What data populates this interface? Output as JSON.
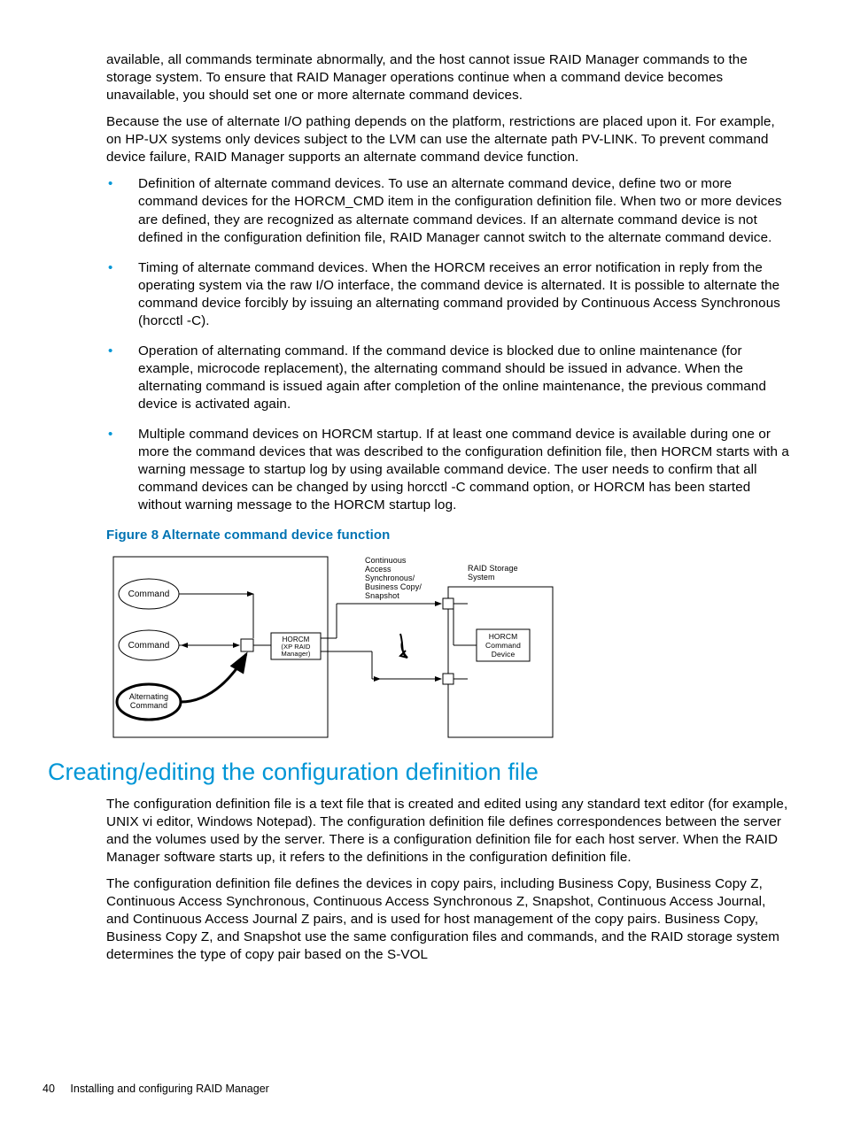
{
  "paragraphs": {
    "p1": "available, all commands terminate abnormally, and the host cannot issue RAID Manager commands to the storage system. To ensure that RAID Manager operations continue when a command device becomes unavailable, you should set one or more alternate command devices.",
    "p2": "Because the use of alternate I/O pathing depends on the platform, restrictions are placed upon it. For example, on HP-UX systems only devices subject to the LVM can use the alternate path PV-LINK. To prevent command device failure, RAID Manager supports an alternate command device function."
  },
  "bullets": [
    "Definition of alternate command devices. To use an alternate command device, define two or more command devices for the HORCM_CMD item in the configuration definition file. When two or more devices are defined, they are recognized as alternate command devices. If an alternate command device is not defined in the configuration definition file, RAID Manager cannot switch to the alternate command device.",
    "Timing of alternate command devices. When the HORCM receives an error notification in reply from the operating system via the raw I/O interface, the command device is alternated. It is possible to alternate the command device forcibly by issuing an alternating command provided by Continuous Access Synchronous (horcctl -C).",
    "Operation of alternating command. If the command device is blocked due to online maintenance (for example, microcode replacement), the alternating command should be issued in advance. When the alternating command is issued again after completion of the online maintenance, the previous command device is activated again.",
    "Multiple command devices on HORCM startup. If at least one command device is available during one or more the command devices that was described to the configuration definition file, then HORCM starts with a warning message to startup log by using available command device. The user needs to confirm that all command devices can be changed by using horcctl -C command option, or HORCM has been started without warning message to the HORCM startup log."
  ],
  "figure": {
    "caption": "Figure 8 Alternate command device function",
    "labels": {
      "cmd1": "Command",
      "cmd2": "Command",
      "alt": "Alternating Command",
      "horcm": "HORCM (XP RAID Manager)",
      "copy": "Continuous Access Synchronous/ Business Copy/ Snapshot",
      "raid": "RAID Storage System",
      "device": "HORCM Command Device"
    }
  },
  "section": {
    "heading": "Creating/editing the configuration definition file",
    "p1": "The configuration definition file is a text file that is created and edited using any standard text editor (for example, UNIX vi editor, Windows Notepad). The configuration definition file defines correspondences between the server and the volumes used by the server. There is a configuration definition file for each host server. When the RAID Manager software starts up, it refers to the definitions in the configuration definition file.",
    "p2": "The configuration definition file defines the devices in copy pairs, including Business Copy, Business Copy Z, Continuous Access Synchronous, Continuous Access Synchronous Z, Snapshot, Continuous Access Journal, and Continuous Access Journal Z pairs, and is used for host management of the copy pairs. Business Copy, Business Copy Z, and Snapshot use the same configuration files and commands, and the RAID storage system determines the type of copy pair based on the S-VOL"
  },
  "footer": {
    "page": "40",
    "title": "Installing and configuring RAID Manager"
  }
}
